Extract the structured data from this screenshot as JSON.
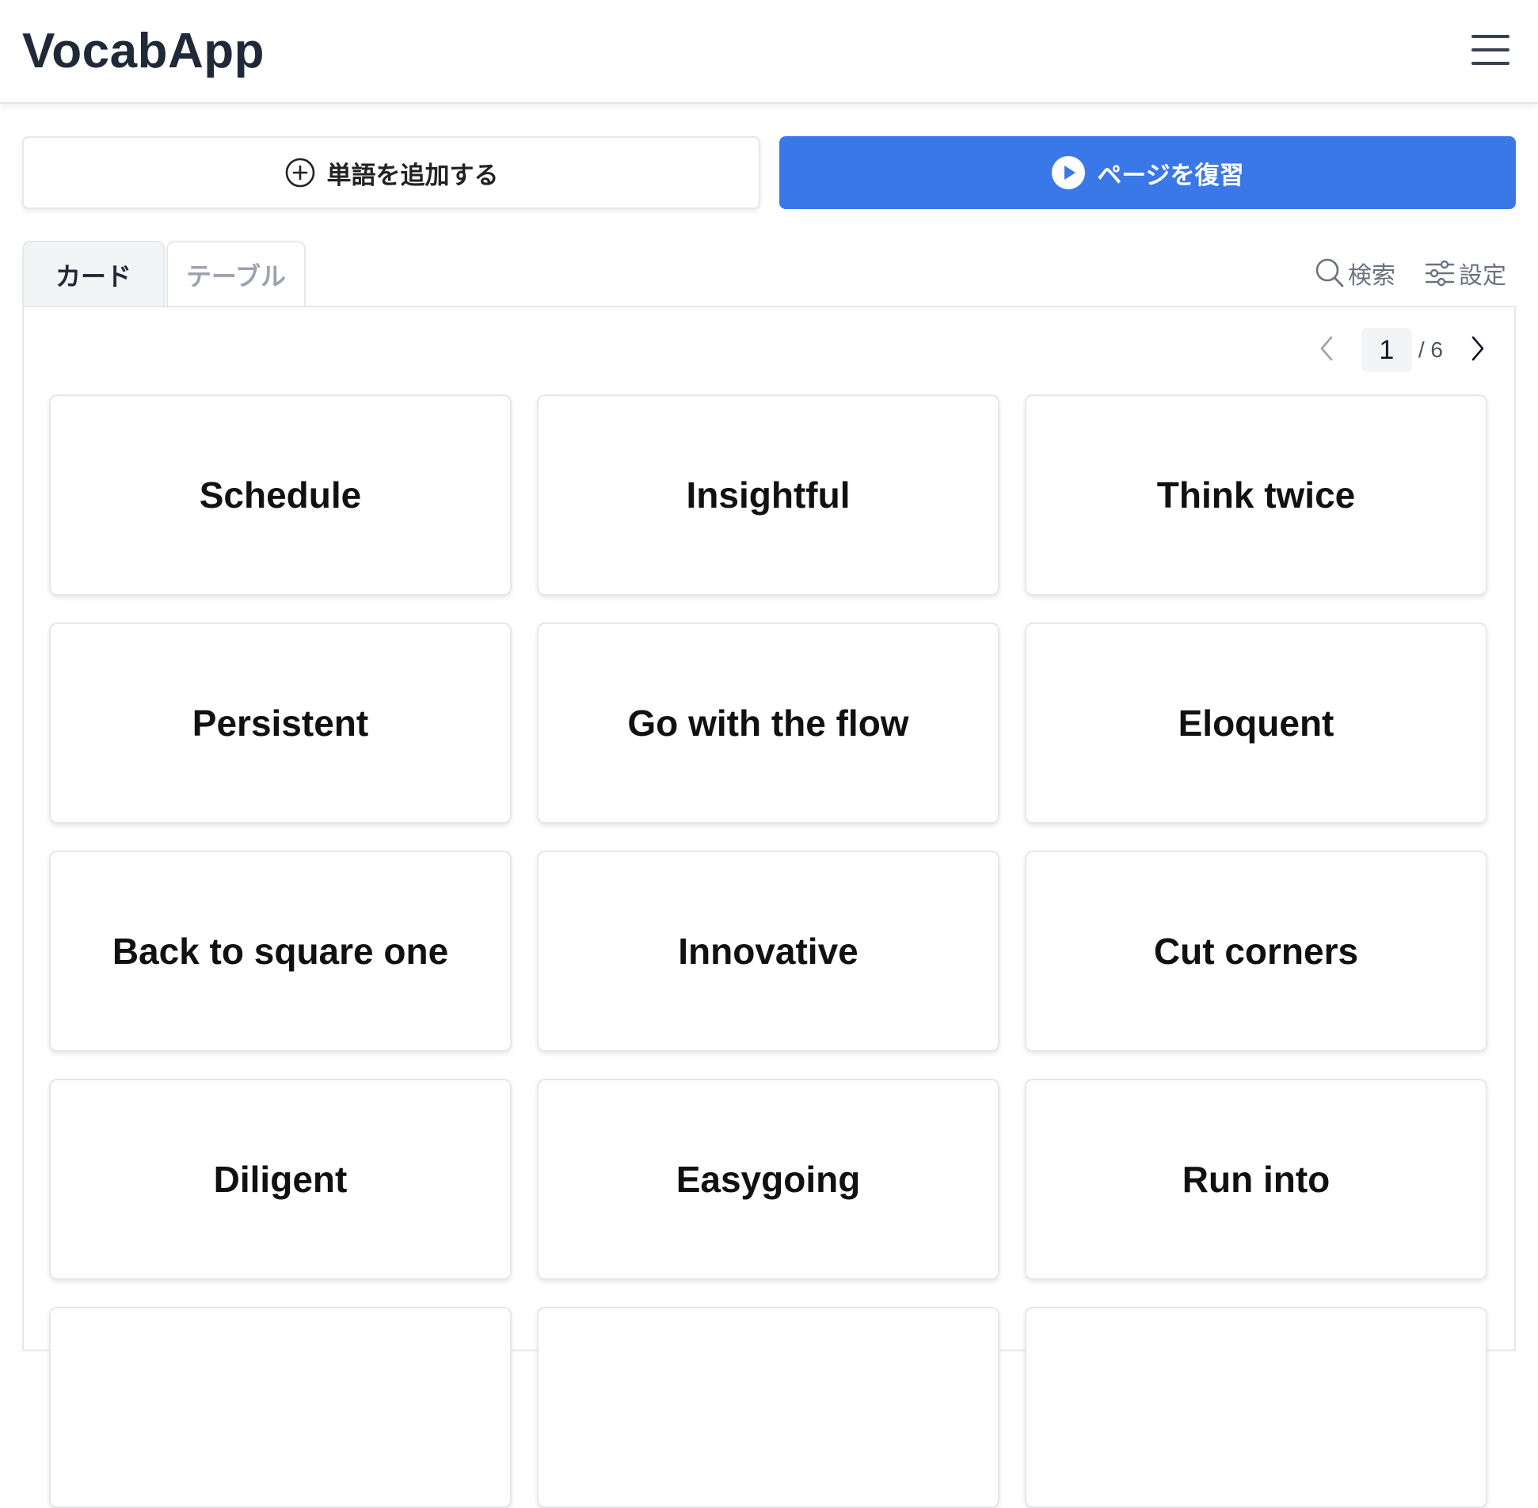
{
  "app": {
    "title": "VocabApp"
  },
  "header": {
    "menu_icon": "hamburger-menu-icon"
  },
  "actions": {
    "add_word": {
      "label": "単語を追加する",
      "icon": "plus-circle-icon"
    },
    "review_page": {
      "label": "ページを復習",
      "icon": "play-circle-icon"
    }
  },
  "tabs": [
    {
      "label": "カード",
      "active": true
    },
    {
      "label": "テーブル",
      "active": false
    }
  ],
  "tools": {
    "search": {
      "label": "検索",
      "icon": "search-icon"
    },
    "settings": {
      "label": "設定",
      "icon": "sliders-icon"
    }
  },
  "pager": {
    "current": "1",
    "total": "/ 6"
  },
  "cards": [
    {
      "word": "Schedule"
    },
    {
      "word": "Insightful"
    },
    {
      "word": "Think twice"
    },
    {
      "word": "Persistent"
    },
    {
      "word": "Go with the flow"
    },
    {
      "word": "Eloquent"
    },
    {
      "word": "Back to square one"
    },
    {
      "word": "Innovative"
    },
    {
      "word": "Cut corners"
    },
    {
      "word": "Diligent"
    },
    {
      "word": "Easygoing"
    },
    {
      "word": "Run into"
    },
    {
      "word": ""
    },
    {
      "word": ""
    },
    {
      "word": ""
    }
  ],
  "colors": {
    "accent": "#3b78e7",
    "title": "#1f2937",
    "muted": "#9ca3af",
    "border": "#e5e7eb"
  }
}
